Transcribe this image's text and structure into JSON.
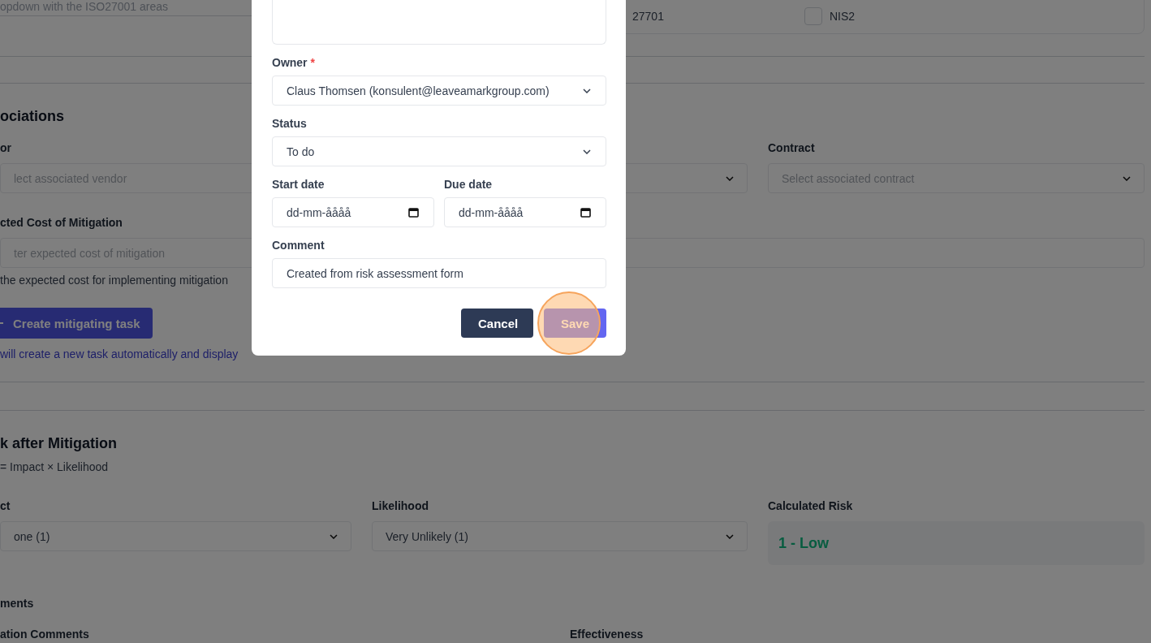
{
  "background_form": {
    "top_field": {
      "placeholder": "opdown with the ISO27001 areas"
    },
    "frameworks": [
      {
        "label": "27701"
      },
      {
        "label": "NIS2",
        "checked": false
      }
    ],
    "associations": {
      "heading": "ociations",
      "fields": [
        {
          "kind": "select",
          "label": "or",
          "placeholder": "lect associated vendor"
        },
        {
          "kind": "select"
        },
        {
          "kind": "select",
          "label": "Contract",
          "placeholder": "Select associated contract"
        }
      ],
      "cost": {
        "label": "cted Cost of Mitigation",
        "placeholder": "ter expected cost of mitigation",
        "help": "the expected cost for implementing mitigation"
      },
      "create_button": {
        "label": "Create mitigating task"
      },
      "create_help": "will create a new task automatically and display"
    },
    "after_mitigation": {
      "heading": "k after Mitigation",
      "formula": "= Impact × Likelihood",
      "impact": {
        "label": "ct",
        "value": "one (1)"
      },
      "likelihood": {
        "label": "Likelihood",
        "value": "Very Unlikely (1)"
      },
      "calculated": {
        "label": "Calculated Risk",
        "value": "1 - Low"
      }
    },
    "comments": {
      "heading": "ments",
      "labels": [
        "ation Comments",
        "Effectiveness"
      ]
    }
  },
  "dialog": {
    "fields": [
      {
        "kind": "select",
        "label": "Owner",
        "required_mark": "*",
        "value": "Claus Thomsen (konsulent@leaveamarkgroup.com)"
      },
      {
        "kind": "select",
        "label": "Status",
        "value": "To do"
      },
      {
        "kind": "dates",
        "items": [
          {
            "label": "Start date",
            "value": "dd-mm-åååå"
          },
          {
            "label": "Due date",
            "value": "dd-mm-åååå"
          }
        ]
      },
      {
        "kind": "text",
        "label": "Comment",
        "value": "Created from risk assessment form"
      }
    ],
    "buttons": [
      {
        "label": "Cancel",
        "kind": "secondary",
        "highlighted": false
      },
      {
        "label": "Save",
        "kind": "primary",
        "highlighted": true
      }
    ]
  }
}
